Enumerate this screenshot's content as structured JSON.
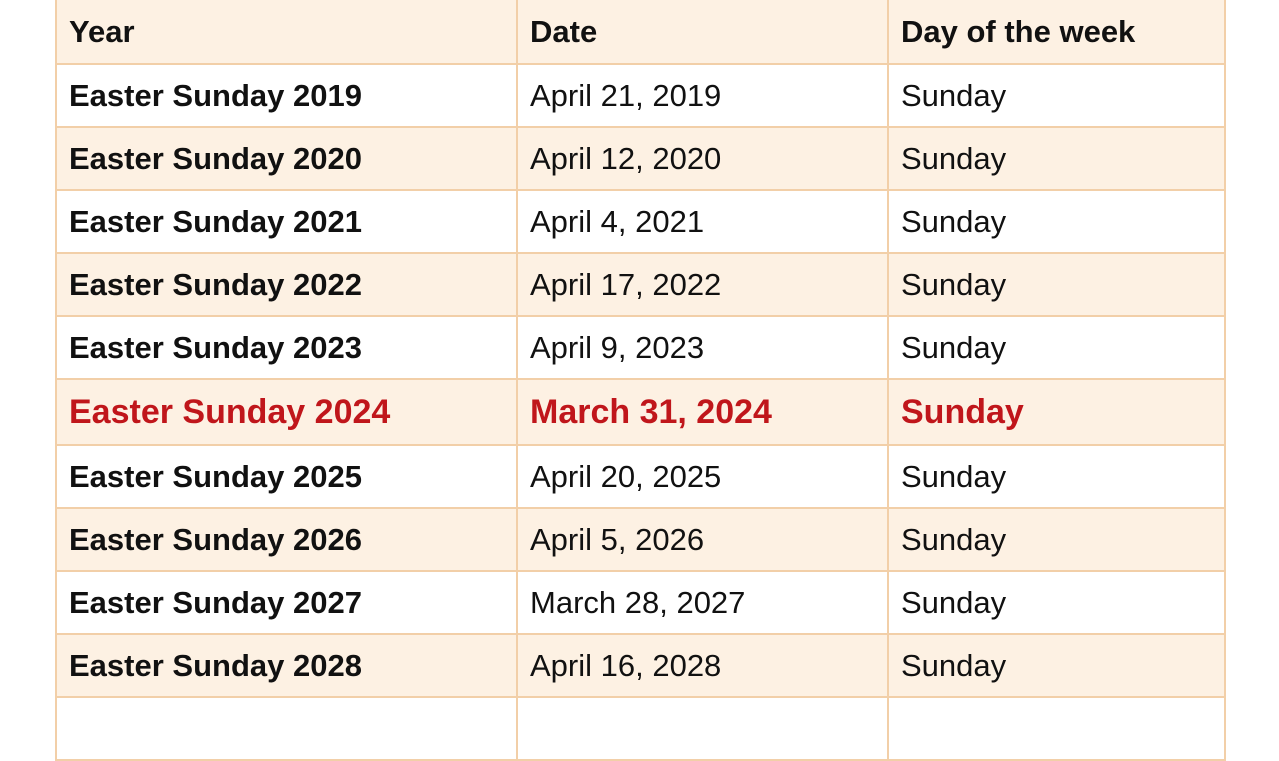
{
  "table": {
    "headers": [
      "Year",
      "Date",
      "Day of the week"
    ],
    "highlight_color": "#c0161b",
    "rows": [
      {
        "year": "Easter Sunday 2019",
        "date": "April 21, 2019",
        "day": "Sunday"
      },
      {
        "year": "Easter Sunday 2020",
        "date": "April 12, 2020",
        "day": "Sunday"
      },
      {
        "year": "Easter Sunday 2021",
        "date": "April 4, 2021",
        "day": "Sunday"
      },
      {
        "year": "Easter Sunday 2022",
        "date": "April 17, 2022",
        "day": "Sunday"
      },
      {
        "year": "Easter Sunday 2023",
        "date": "April 9, 2023",
        "day": "Sunday"
      },
      {
        "year": "Easter Sunday 2024",
        "date": "March 31, 2024",
        "day": "Sunday",
        "highlighted": true
      },
      {
        "year": "Easter Sunday 2025",
        "date": "April 20, 2025",
        "day": "Sunday"
      },
      {
        "year": "Easter Sunday 2026",
        "date": "April 5, 2026",
        "day": "Sunday"
      },
      {
        "year": "Easter Sunday 2027",
        "date": "March 28, 2027",
        "day": "Sunday"
      },
      {
        "year": "Easter Sunday 2028",
        "date": "April 16, 2028",
        "day": "Sunday"
      }
    ]
  }
}
